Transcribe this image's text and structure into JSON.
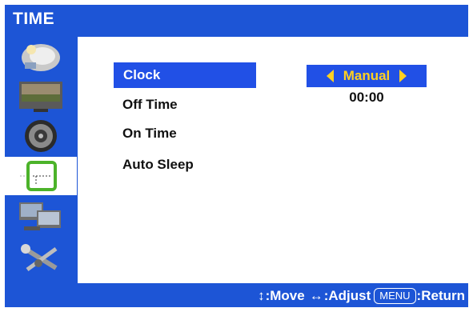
{
  "window": {
    "title": "TIME"
  },
  "sidebar": {
    "items": [
      {
        "icon": "picture-icon"
      },
      {
        "icon": "screen-icon"
      },
      {
        "icon": "audio-icon"
      },
      {
        "icon": "time-icon",
        "active": true
      },
      {
        "icon": "pc-settings-icon"
      },
      {
        "icon": "setup-tools-icon"
      }
    ]
  },
  "menu": {
    "items": [
      {
        "label": "Clock",
        "selected": true
      },
      {
        "label": "Off Time"
      },
      {
        "label": "On Time"
      },
      {
        "label": "Auto Sleep"
      }
    ]
  },
  "values": {
    "clock_mode": "Manual",
    "clock_time": "00:00"
  },
  "footer": {
    "move_symbol": "↕",
    "move_label": ":Move",
    "adjust_symbol": "↔",
    "adjust_label": ":Adjust",
    "menu_key": "MENU",
    "return_label": ":Return"
  },
  "colors": {
    "frame_blue": "#1d55d6",
    "selection_blue": "#2150e6",
    "value_yellow": "#ffd020"
  }
}
